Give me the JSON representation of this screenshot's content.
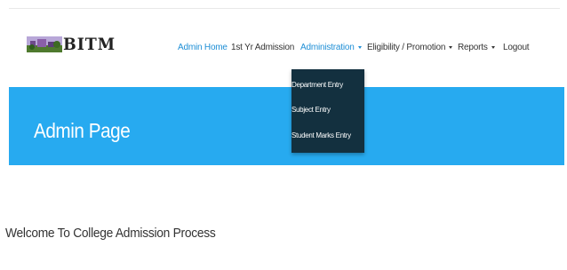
{
  "brand": {
    "name": "BITM",
    "logo_icon": "campus-logo-icon"
  },
  "nav": {
    "admin_home": "Admin Home",
    "first_yr_admission": "1st Yr Admission",
    "administration": "Administration",
    "eligibility": "Eligibility / Promotion",
    "reports": "Reports",
    "logout": "Logout"
  },
  "dropdown": {
    "items": [
      "Department Entry",
      "Subject Entry",
      "Student Marks Entry"
    ]
  },
  "hero": {
    "title": "Admin Page"
  },
  "main": {
    "welcome": "Welcome To College Admission Process"
  },
  "colors": {
    "accent": "#1f8fd6",
    "hero_bg": "#27aaf0",
    "dropdown_bg": "#13303f"
  }
}
